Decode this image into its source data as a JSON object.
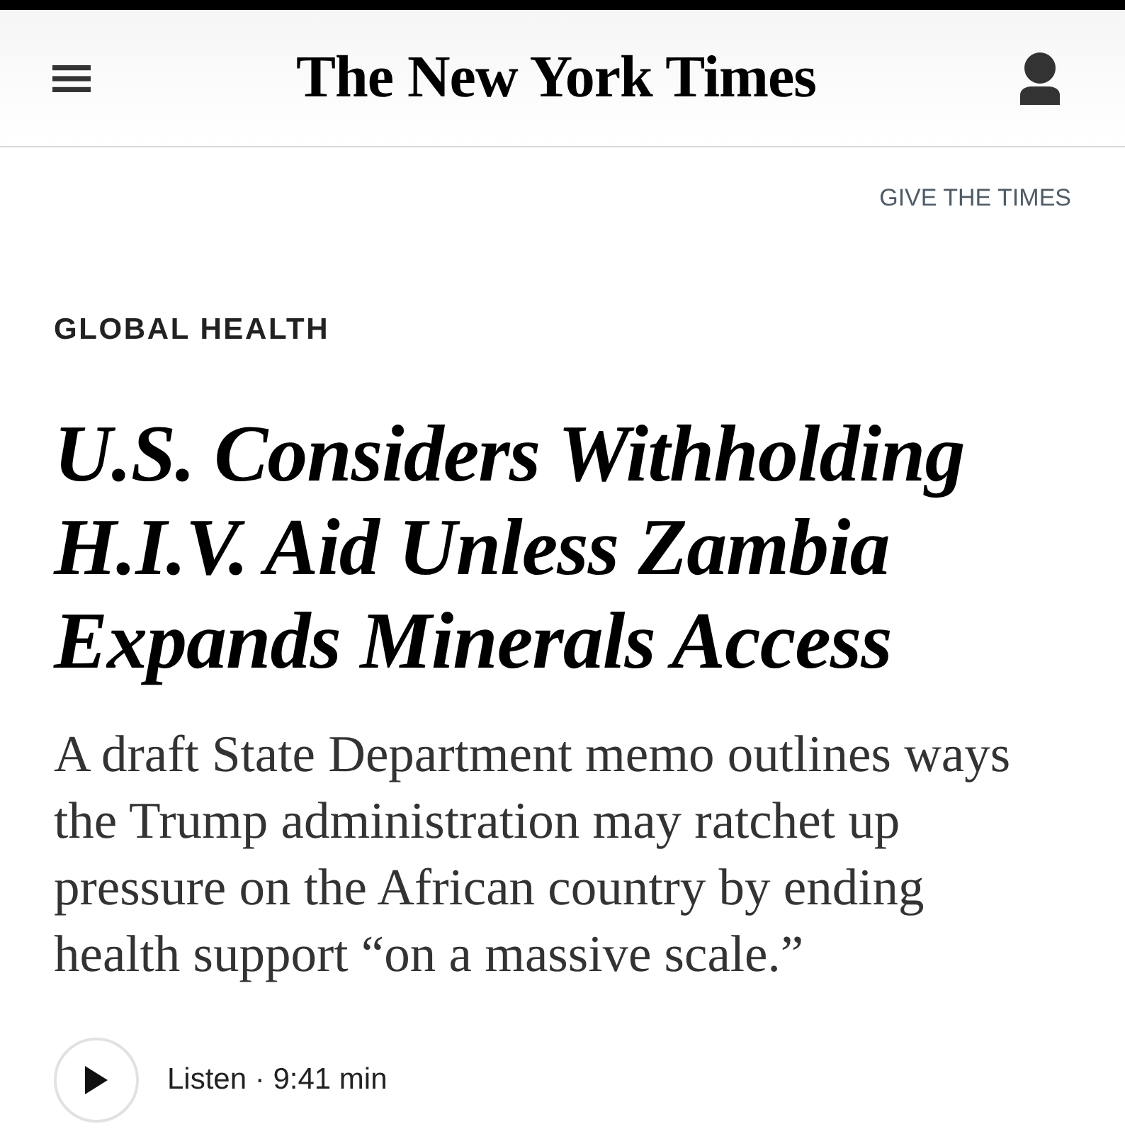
{
  "header": {
    "logo": "The New York Times"
  },
  "give_link": {
    "label": "GIVE THE TIMES"
  },
  "article": {
    "section": "GLOBAL HEALTH",
    "headline": "U.S. Considers Withholding H.I.V. Aid Unless Zambia Expands Minerals Access",
    "summary": "A draft State Department memo outlines ways the Trump administration may ratchet up pressure on the African country by ending health support “on a massive scale.”",
    "listen": {
      "label": "Listen · 9:41 min"
    }
  }
}
